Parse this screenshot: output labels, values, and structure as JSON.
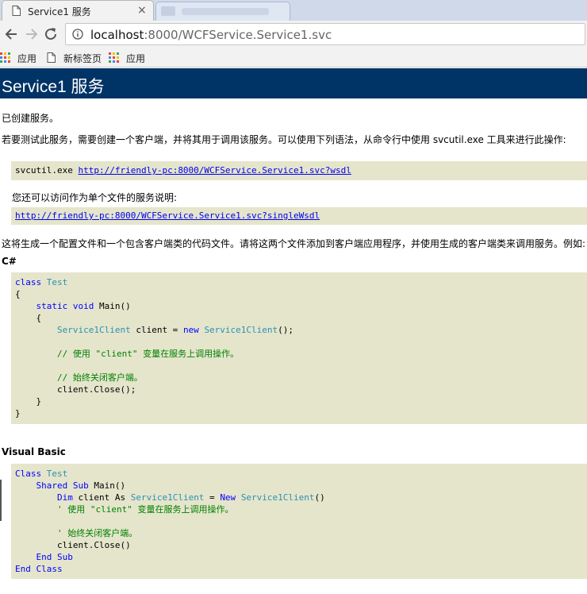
{
  "browser": {
    "active_tab_title": "Service1 服务",
    "tab_close": "×",
    "address_host": "localhost",
    "address_rest": ":8000/WCFService.Service1.svc",
    "bookmarks": [
      {
        "label": "应用",
        "icon": "apps-grid-icon"
      },
      {
        "label": "新标签页",
        "icon": "page-icon"
      },
      {
        "label": "应用",
        "icon": "apps-grid-icon"
      }
    ]
  },
  "page": {
    "title": "Service1 服务",
    "created": "已创建服务。",
    "test_intro": "若要测试此服务，需要创建一个客户端，并将其用于调用该服务。可以使用下列语法，从命令行中使用 svcutil.exe 工具来进行此操作:",
    "svcutil_cmd": "svcutil.exe ",
    "wsdl_url": "http://friendly-pc:8000/WCFService.Service1.svc?wsdl",
    "single_file_intro": "您还可以访问作为单个文件的服务说明:",
    "single_wsdl_url": "http://friendly-pc:8000/WCFService.Service1.svc?singleWsdl",
    "generate_note": "这将生成一个配置文件和一个包含客户端类的代码文件。请将这两个文件添加到客户端应用程序，并使用生成的客户端类来调用服务。例如:",
    "csharp_heading": "C#",
    "vb_heading": "Visual Basic",
    "csharp_code": [
      [
        {
          "t": "class ",
          "c": "kw"
        },
        {
          "t": "Test",
          "c": "ty"
        }
      ],
      [
        {
          "t": "{"
        }
      ],
      [
        {
          "t": "    "
        },
        {
          "t": "static ",
          "c": "kw"
        },
        {
          "t": "void ",
          "c": "kw"
        },
        {
          "t": "Main()"
        }
      ],
      [
        {
          "t": "    {"
        }
      ],
      [
        {
          "t": "        "
        },
        {
          "t": "Service1Client",
          "c": "ty"
        },
        {
          "t": " client = "
        },
        {
          "t": "new ",
          "c": "kw"
        },
        {
          "t": "Service1Client",
          "c": "ty"
        },
        {
          "t": "();"
        }
      ],
      [
        {
          "t": ""
        }
      ],
      [
        {
          "t": "        "
        },
        {
          "t": "// 使用 \"client\" 变量在服务上调用操作。",
          "c": "cm"
        }
      ],
      [
        {
          "t": ""
        }
      ],
      [
        {
          "t": "        "
        },
        {
          "t": "// 始终关闭客户端。",
          "c": "cm"
        }
      ],
      [
        {
          "t": "        client.Close();"
        }
      ],
      [
        {
          "t": "    }"
        }
      ],
      [
        {
          "t": "}"
        }
      ]
    ],
    "vb_code": [
      [
        {
          "t": "Class ",
          "c": "kw"
        },
        {
          "t": "Test",
          "c": "ty"
        }
      ],
      [
        {
          "t": "    "
        },
        {
          "t": "Shared ",
          "c": "kw"
        },
        {
          "t": "Sub ",
          "c": "kw"
        },
        {
          "t": "Main()"
        }
      ],
      [
        {
          "t": "        "
        },
        {
          "t": "Dim ",
          "c": "kw"
        },
        {
          "t": "client As "
        },
        {
          "t": "Service1Client",
          "c": "ty"
        },
        {
          "t": " = "
        },
        {
          "t": "New ",
          "c": "kw"
        },
        {
          "t": "Service1Client",
          "c": "ty"
        },
        {
          "t": "()"
        }
      ],
      [
        {
          "t": "        "
        },
        {
          "t": "' 使用 \"client\" 变量在服务上调用操作。",
          "c": "cm"
        }
      ],
      [
        {
          "t": ""
        }
      ],
      [
        {
          "t": "        "
        },
        {
          "t": "' 始终关闭客户端。",
          "c": "cm"
        }
      ],
      [
        {
          "t": "        client.Close()"
        }
      ],
      [
        {
          "t": "    "
        },
        {
          "t": "End ",
          "c": "kw"
        },
        {
          "t": "Sub",
          "c": "kw"
        }
      ],
      [
        {
          "t": "End ",
          "c": "kw"
        },
        {
          "t": "Class",
          "c": "kw"
        }
      ]
    ]
  },
  "colors": {
    "header_bg": "#003366",
    "code_bg": "#e5e5cc",
    "keyword": "#0000ff",
    "type": "#2b91af",
    "comment": "#008000",
    "link": "#0000ee"
  }
}
